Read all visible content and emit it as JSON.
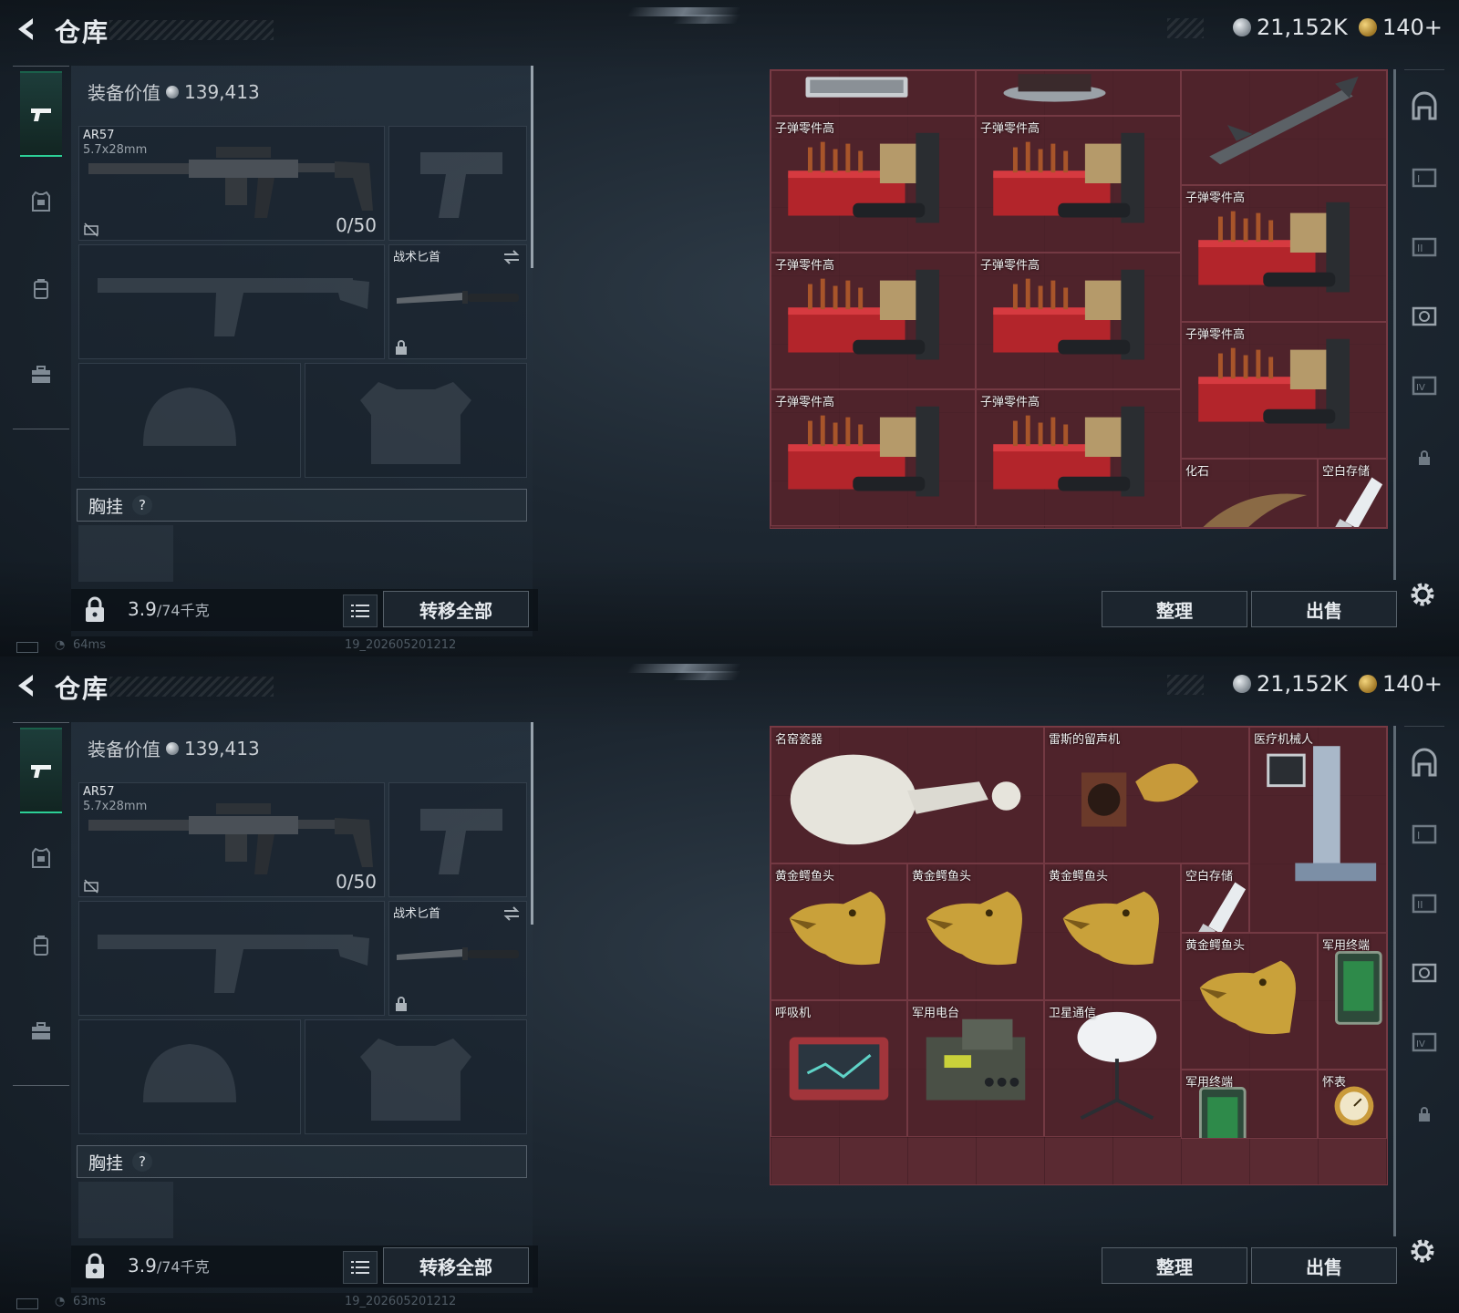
{
  "header": {
    "title": "仓库"
  },
  "currency": {
    "silver": "21,152K",
    "gold": "140+"
  },
  "equipment": {
    "value_label": "装备价值",
    "value": "139,413",
    "primary_weapon": {
      "name": "AR57",
      "caliber": "5.7x28mm",
      "ammo": "0/50"
    },
    "melee": {
      "name": "战术匕首"
    },
    "chest_rig_label": "胸挂",
    "help": "?"
  },
  "bag": {
    "weight": "3.9",
    "capacity": "/74千克"
  },
  "buttons": {
    "transfer_all": "转移全部",
    "sort": "整理",
    "sell": "出售"
  },
  "status": [
    {
      "ping": "64ms",
      "build": "19_202605201212"
    },
    {
      "ping": "63ms",
      "build": "19_202605201212"
    }
  ],
  "storage_top": [
    {
      "name": "",
      "icon": "keyboard-icon"
    },
    {
      "name": "",
      "icon": "dome-device-icon"
    },
    {
      "name": "",
      "icon": "missile-icon"
    },
    {
      "name": "子弹零件高",
      "icon": "ammo-parts-icon"
    },
    {
      "name": "子弹零件高",
      "icon": "ammo-parts-icon"
    },
    {
      "name": "子弹零件高",
      "icon": "ammo-parts-icon"
    },
    {
      "name": "子弹零件高",
      "icon": "ammo-parts-icon"
    },
    {
      "name": "子弹零件高",
      "icon": "ammo-parts-icon"
    },
    {
      "name": "子弹零件高",
      "icon": "ammo-parts-icon"
    },
    {
      "name": "子弹零件高",
      "icon": "ammo-parts-icon"
    },
    {
      "name": "子弹零件高",
      "icon": "ammo-parts-icon"
    },
    {
      "name": "化石",
      "icon": "fossil-icon"
    },
    {
      "name": "空白存储",
      "icon": "usb-drive-icon"
    }
  ],
  "storage_bottom": [
    {
      "name": "名窑瓷器",
      "icon": "porcelain-vase-icon"
    },
    {
      "name": "雷斯的留声机",
      "icon": "gramophone-icon"
    },
    {
      "name": "医疗机械人",
      "icon": "medical-robot-icon"
    },
    {
      "name": "黄金鳄鱼头",
      "icon": "gold-crocodile-icon"
    },
    {
      "name": "黄金鳄鱼头",
      "icon": "gold-crocodile-icon"
    },
    {
      "name": "黄金鳄鱼头",
      "icon": "gold-crocodile-icon"
    },
    {
      "name": "空白存储",
      "icon": "usb-drive-icon"
    },
    {
      "name": "黄金鳄鱼头",
      "icon": "gold-crocodile-icon"
    },
    {
      "name": "军用终端",
      "icon": "military-terminal-icon"
    },
    {
      "name": "呼吸机",
      "icon": "ventilator-icon"
    },
    {
      "name": "军用电台",
      "icon": "military-radio-icon"
    },
    {
      "name": "卫星通信",
      "icon": "satellite-dish-icon"
    },
    {
      "name": "军用终端",
      "icon": "military-terminal-icon"
    },
    {
      "name": "怀表",
      "icon": "pocket-watch-icon"
    }
  ],
  "colors": {
    "accent": "#2ccf96",
    "storage_bg": "#5a2a32",
    "panel_bg": "#1c252e"
  }
}
